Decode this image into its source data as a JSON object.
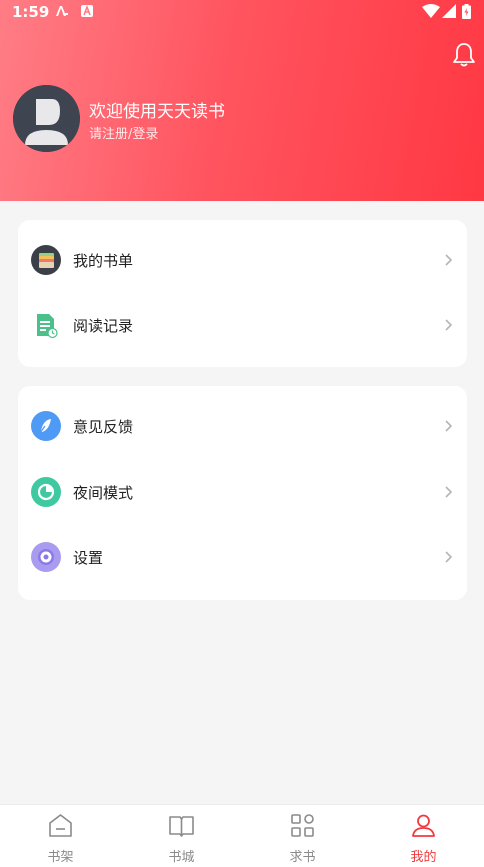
{
  "status_bar": {
    "time": "1:59"
  },
  "profile": {
    "welcome_text": "欢迎使用天天读书",
    "login_text": "请注册/登录"
  },
  "menu_group_1": [
    {
      "label": "我的书单",
      "icon": "booklist-icon"
    },
    {
      "label": "阅读记录",
      "icon": "reading-history-icon"
    }
  ],
  "menu_group_2": [
    {
      "label": "意见反馈",
      "icon": "feedback-icon"
    },
    {
      "label": "夜间模式",
      "icon": "night-mode-icon"
    },
    {
      "label": "设置",
      "icon": "settings-icon"
    }
  ],
  "tabs": [
    {
      "label": "书架",
      "icon": "bookshelf-icon",
      "active": false
    },
    {
      "label": "书城",
      "icon": "bookstore-icon",
      "active": false
    },
    {
      "label": "求书",
      "icon": "request-book-icon",
      "active": false
    },
    {
      "label": "我的",
      "icon": "profile-icon",
      "active": true
    }
  ],
  "colors": {
    "header_gradient_start": "#ff7d86",
    "header_gradient_end": "#ff3843",
    "active_tab": "#f03a40",
    "inactive_tab": "#8a8a8a",
    "background": "#f5f5f6"
  }
}
